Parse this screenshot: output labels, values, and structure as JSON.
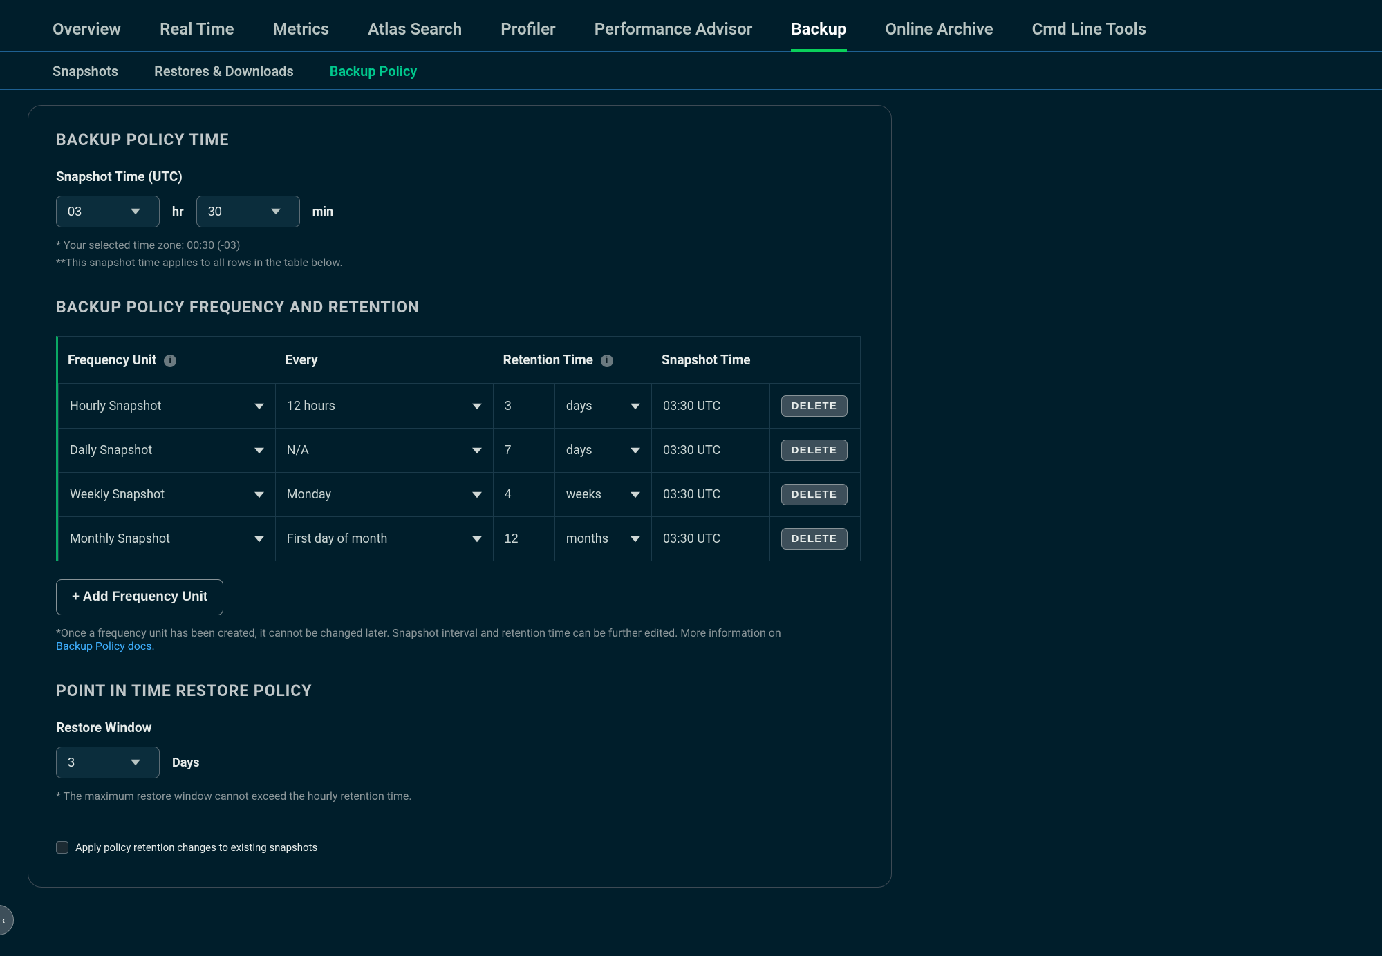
{
  "tabs": {
    "items": [
      {
        "label": "Overview"
      },
      {
        "label": "Real Time"
      },
      {
        "label": "Metrics"
      },
      {
        "label": "Atlas Search"
      },
      {
        "label": "Profiler"
      },
      {
        "label": "Performance Advisor"
      },
      {
        "label": "Backup",
        "active": true
      },
      {
        "label": "Online Archive"
      },
      {
        "label": "Cmd Line Tools"
      }
    ]
  },
  "subtabs": {
    "items": [
      {
        "label": "Snapshots"
      },
      {
        "label": "Restores & Downloads"
      },
      {
        "label": "Backup Policy",
        "active": true
      }
    ]
  },
  "policy_time": {
    "heading": "BACKUP POLICY TIME",
    "snapshot_label": "Snapshot Time (UTC)",
    "hour": "03",
    "hr_label": "hr",
    "minute": "30",
    "min_label": "min",
    "note1": "* Your selected time zone: 00:30 (-03)",
    "note2": "**This snapshot time applies to all rows in the table below."
  },
  "freq": {
    "heading": "BACKUP POLICY FREQUENCY AND RETENTION",
    "cols": {
      "freq_unit": "Frequency Unit",
      "every": "Every",
      "retention": "Retention Time",
      "snapshot_time": "Snapshot Time"
    },
    "rows": [
      {
        "unit": "Hourly Snapshot",
        "every": "12 hours",
        "ret_num": "3",
        "ret_unit": "days",
        "time": "03:30 UTC"
      },
      {
        "unit": "Daily Snapshot",
        "every": "N/A",
        "ret_num": "7",
        "ret_unit": "days",
        "time": "03:30 UTC"
      },
      {
        "unit": "Weekly Snapshot",
        "every": "Monday",
        "ret_num": "4",
        "ret_unit": "weeks",
        "time": "03:30 UTC"
      },
      {
        "unit": "Monthly Snapshot",
        "every": "First day of month",
        "ret_num": "12",
        "ret_unit": "months",
        "time": "03:30 UTC"
      }
    ],
    "delete_label": "DELETE",
    "add_button": "+ Add Frequency Unit",
    "footnote_a": "*Once a frequency unit has been created, it cannot be changed later. Snapshot interval and retention time can be further edited. More information on ",
    "footnote_link": "Backup Policy docs.",
    "info_glyph": "i"
  },
  "pitr": {
    "heading": "POINT IN TIME RESTORE POLICY",
    "restore_label": "Restore Window",
    "value": "3",
    "unit": "Days",
    "note": "* The maximum restore window cannot exceed the hourly retention time."
  },
  "apply_checkbox": {
    "label": "Apply policy retention changes to existing snapshots"
  },
  "edge_btn": {
    "glyph": "‹"
  }
}
